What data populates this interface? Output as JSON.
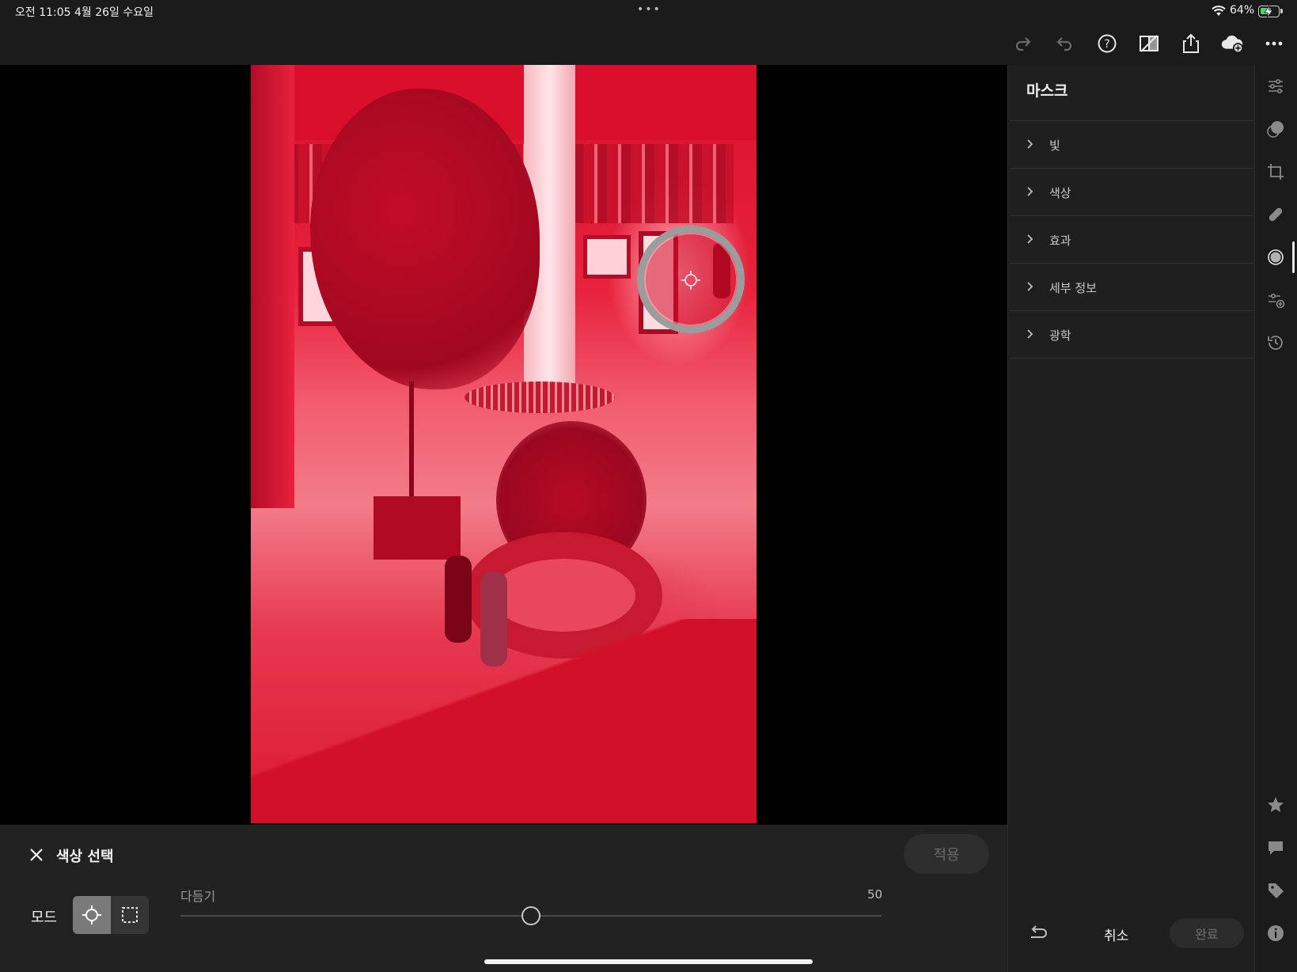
{
  "status_bar": {
    "time": "오전 11:05   4월 26일 수요일",
    "dots": "•••",
    "battery_pct": "64%",
    "battery_level": 0.64
  },
  "toolbar": {
    "icons": [
      "redo-icon",
      "undo-icon",
      "help-icon",
      "compare-off-icon",
      "share-icon",
      "cloud-add-icon",
      "more-icon"
    ]
  },
  "mask_panel": {
    "title": "마스크",
    "sections": [
      {
        "label": "빛"
      },
      {
        "label": "색상"
      },
      {
        "label": "효과"
      },
      {
        "label": "세부 정보"
      },
      {
        "label": "광학"
      }
    ],
    "cancel_label": "취소",
    "done_label": "완료"
  },
  "color_select_panel": {
    "title": "색상 선택",
    "apply_label": "적용",
    "mode_label": "모드",
    "slider": {
      "label": "다듬기",
      "value": 50,
      "min": 0,
      "max": 100
    }
  },
  "colors": {
    "background": "#1b1b1b",
    "mask_overlay": "#e0102e",
    "battery_green": "#54d26a"
  }
}
